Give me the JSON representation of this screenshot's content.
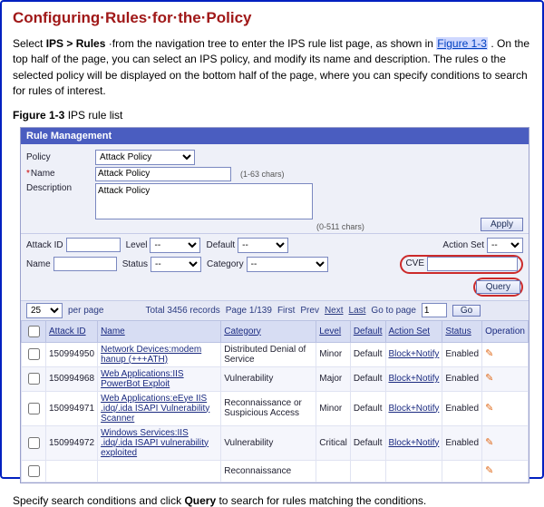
{
  "doc": {
    "heading": "Configuring·Rules·for·the·Policy",
    "para": {
      "pre": "Select ",
      "nav": "IPS > Rules",
      "mid1": "·from the navigation tree to enter the IPS rule list page, as shown in ",
      "figref": "Figure 1-3",
      "mid2": ". On the top half of the page, you can select an IPS policy, and modify its name and description. The rules o the selected policy will be displayed on the bottom half of the page, where you can specify conditions to search for rules of interest."
    },
    "fig_caption_b": "Figure 1-3",
    "fig_caption_t": " IPS rule list",
    "bottom": {
      "pre": "Specify search conditions and click ",
      "q": "Query",
      "post": " to search for rules matching the conditions."
    }
  },
  "panel": {
    "title": "Rule Management"
  },
  "form": {
    "policy_label": "Policy",
    "policy_value": "Attack Policy",
    "name_label": "Name",
    "name_value": "Attack Policy",
    "name_hint": "(1-63  chars)",
    "desc_label": "Description",
    "desc_value": "Attack Policy",
    "desc_hint": "(0-511  chars)",
    "apply": "Apply"
  },
  "filters": {
    "attack_id": "Attack ID",
    "level": "Level",
    "level_v": "--",
    "default": "Default",
    "default_v": "--",
    "action_set": "Action Set",
    "action_set_v": "--",
    "name": "Name",
    "status": "Status",
    "status_v": "--",
    "category": "Category",
    "category_v": "--",
    "cve": "CVE",
    "query": "Query"
  },
  "pager": {
    "per_page_value": "25",
    "per_page_label": "per page",
    "total": "Total 3456 records",
    "page": "Page 1/139",
    "first": "First",
    "prev": "Prev",
    "next": "Next",
    "last": "Last",
    "goto_label": "Go to page",
    "goto_value": "1",
    "go": "Go"
  },
  "columns": {
    "attack_id": "Attack ID",
    "name": "Name",
    "category": "Category",
    "level": "Level",
    "default": "Default",
    "action_set": "Action Set",
    "status": "Status",
    "operation": "Operation"
  },
  "rows": [
    {
      "id": "150994950",
      "name": "Network Devices:modem hanup (+++ATH)",
      "category": "Distributed Denial of Service",
      "level": "Minor",
      "def": "Default",
      "action": "Block+Notify",
      "status": "Enabled"
    },
    {
      "id": "150994968",
      "name": "Web Applications:IIS PowerBot Exploit",
      "category": "Vulnerability",
      "level": "Major",
      "def": "Default",
      "action": "Block+Notify",
      "status": "Enabled"
    },
    {
      "id": "150994971",
      "name": "Web Applications:eEye IIS .idq/.ida ISAPI Vulnerability Scanner",
      "category": "Reconnaissance or Suspicious Access",
      "level": "Minor",
      "def": "Default",
      "action": "Block+Notify",
      "status": "Enabled"
    },
    {
      "id": "150994972",
      "name": "Windows Services:IIS .idq/.ida ISAPI vulnerability exploited",
      "category": "Vulnerability",
      "level": "Critical",
      "def": "Default",
      "action": "Block+Notify",
      "status": "Enabled"
    },
    {
      "id": "",
      "name": "",
      "category": "Reconnaissance",
      "level": "",
      "def": "",
      "action": "",
      "status": ""
    }
  ]
}
